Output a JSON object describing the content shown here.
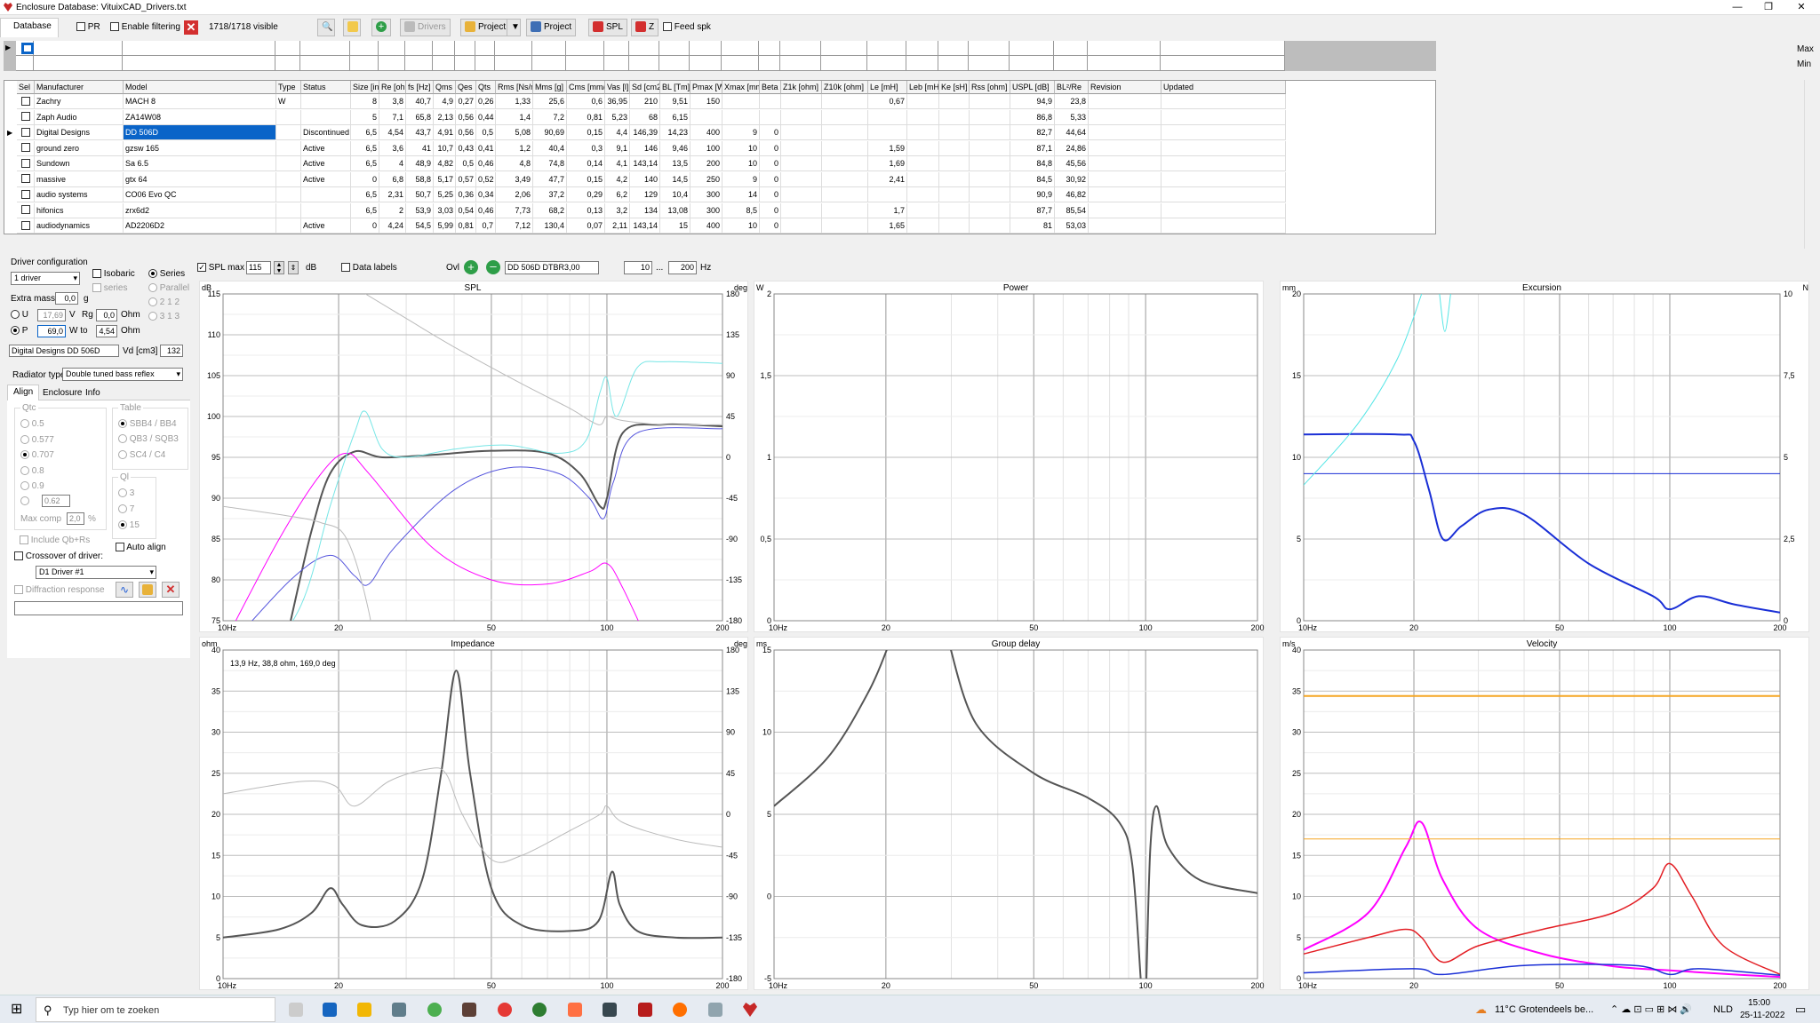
{
  "window": {
    "title": "Enclosure  Database: VituixCAD_Drivers.txt"
  },
  "toolbar": {
    "tab": "Database",
    "pr_label": "PR",
    "filter_label": "Enable filtering",
    "visible_count": "1718/1718 visible",
    "drivers_label": "Drivers",
    "project_label": "Project",
    "project2_label": "Project",
    "spl_label": "SPL",
    "z_label": "Z",
    "feedspk_label": "Feed spk"
  },
  "filter": {
    "max_label": "Max",
    "min_label": "Min"
  },
  "grid": {
    "columns": [
      "Sel",
      "Manufacturer",
      "Model",
      "Type",
      "Status",
      "Size [in]",
      "Re [ohm]",
      "fs [Hz]",
      "Qms",
      "Qes",
      "Qts",
      "Rms [Ns/m]",
      "Mms [g]",
      "Cms [mm/N]",
      "Vas [l]",
      "Sd [cm2]",
      "BL [Tm]",
      "Pmax [W]",
      "Xmax [mm]",
      "Beta",
      "Z1k [ohm]",
      "Z10k [ohm]",
      "Le [mH]",
      "Leb [mH]",
      "Ke [sH]",
      "Rss [ohm]",
      "USPL [dB]",
      "BL²/Re",
      "Revision",
      "Updated"
    ],
    "rows": [
      [
        "",
        "Zachry",
        "MACH 8",
        "W",
        "",
        "8",
        "3,8",
        "40,7",
        "4,9",
        "0,27",
        "0,26",
        "1,33",
        "25,6",
        "0,6",
        "36,95",
        "210",
        "9,51",
        "150",
        "",
        "",
        "",
        "",
        "0,67",
        "",
        "",
        "",
        "94,9",
        "23,8",
        "",
        ""
      ],
      [
        "",
        "Zaph Audio",
        "ZA14W08",
        "",
        "",
        "5",
        "7,1",
        "65,8",
        "2,13",
        "0,56",
        "0,44",
        "1,4",
        "7,2",
        "0,81",
        "5,23",
        "68",
        "6,15",
        "",
        "",
        "",
        "",
        "",
        "",
        "",
        "",
        "",
        "86,8",
        "5,33",
        "",
        ""
      ],
      [
        "",
        "Digital Designs",
        "DD 506D",
        "",
        "Discontinued",
        "6,5",
        "4,54",
        "43,7",
        "4,91",
        "0,56",
        "0,5",
        "5,08",
        "90,69",
        "0,15",
        "4,4",
        "146,39",
        "14,23",
        "400",
        "9",
        "0",
        "",
        "",
        "",
        "",
        "",
        "",
        "82,7",
        "44,64",
        "",
        ""
      ],
      [
        "",
        "ground zero",
        "gzsw 165",
        "",
        "Active",
        "6,5",
        "3,6",
        "41",
        "10,7",
        "0,43",
        "0,41",
        "1,2",
        "40,4",
        "0,3",
        "9,1",
        "146",
        "9,46",
        "100",
        "10",
        "0",
        "",
        "",
        "1,59",
        "",
        "",
        "",
        "87,1",
        "24,86",
        "",
        ""
      ],
      [
        "",
        "Sundown",
        "Sa 6.5",
        "",
        "Active",
        "6,5",
        "4",
        "48,9",
        "4,82",
        "0,5",
        "0,46",
        "4,8",
        "74,8",
        "0,14",
        "4,1",
        "143,14",
        "13,5",
        "200",
        "10",
        "0",
        "",
        "",
        "1,69",
        "",
        "",
        "",
        "84,8",
        "45,56",
        "",
        ""
      ],
      [
        "",
        "massive",
        "gtx 64",
        "",
        "Active",
        "0",
        "6,8",
        "58,8",
        "5,17",
        "0,57",
        "0,52",
        "3,49",
        "47,7",
        "0,15",
        "4,2",
        "140",
        "14,5",
        "250",
        "9",
        "0",
        "",
        "",
        "2,41",
        "",
        "",
        "",
        "84,5",
        "30,92",
        "",
        ""
      ],
      [
        "",
        "audio systems",
        "CO06 Evo QC",
        "",
        "",
        "6,5",
        "2,31",
        "50,7",
        "5,25",
        "0,36",
        "0,34",
        "2,06",
        "37,2",
        "0,29",
        "6,2",
        "129",
        "10,4",
        "300",
        "14",
        "0",
        "",
        "",
        "",
        "",
        "",
        "",
        "90,9",
        "46,82",
        "",
        ""
      ],
      [
        "",
        "hifonics",
        "zrx6d2",
        "",
        "",
        "6,5",
        "2",
        "53,9",
        "3,03",
        "0,54",
        "0,46",
        "7,73",
        "68,2",
        "0,13",
        "3,2",
        "134",
        "13,08",
        "300",
        "8,5",
        "0",
        "",
        "",
        "1,7",
        "",
        "",
        "",
        "87,7",
        "85,54",
        "",
        ""
      ],
      [
        "",
        "audiodynamics",
        "AD2206D2",
        "",
        "Active",
        "0",
        "4,24",
        "54,5",
        "5,99",
        "0,81",
        "0,7",
        "7,12",
        "130,4",
        "0,07",
        "2,11",
        "143,14",
        "15",
        "400",
        "10",
        "0",
        "",
        "",
        "1,65",
        "",
        "",
        "",
        "81",
        "53,03",
        "",
        ""
      ]
    ]
  },
  "left": {
    "driver_config": "Driver configuration",
    "drivers_sel": "1 driver",
    "isobaric": "Isobaric",
    "series": "Series",
    "series2": "series",
    "parallel": "Parallel",
    "extra_mass": "Extra mass",
    "extra_mass_val": "0,0",
    "g": "g",
    "u": "U",
    "u_val": "17,69",
    "v": "V",
    "rg": "Rg",
    "rg_val": "0,0",
    "ohm": "Ohm",
    "p": "P",
    "p_val": "69,0",
    "wto": "W to",
    "wto_val": "4,54",
    "ohm2": "Ohm",
    "r212": "2 1 2",
    "r313": "3 1 3",
    "driver_name": "Digital Designs DD 506D",
    "vd_label": "Vd [cm3]",
    "vd_val": "132",
    "radiator_label": "Radiator type",
    "radiator_val": "Double tuned bass reflex",
    "tabs": [
      "Align",
      "Enclosure",
      "Info"
    ],
    "qtc": "Qtc",
    "qtc_opts": [
      "0.5",
      "0.577",
      "0.707",
      "0.8",
      "0.9"
    ],
    "qtc_custom": "0.62",
    "table": "Table",
    "table_opts": [
      "SBB4 / BB4",
      "QB3 / SQB3",
      "SC4 / C4"
    ],
    "ql": "Ql",
    "ql_opts": [
      "3",
      "7",
      "15"
    ],
    "max_comp": "Max comp",
    "max_comp_val": "2,0",
    "pct": "%",
    "include": "Include Qb+Rs",
    "auto_align": "Auto align",
    "crossover": "Crossover of driver:",
    "crossover_sel": "D1 Driver #1",
    "diffraction": "Diffraction response"
  },
  "chartbar": {
    "splmax": "SPL max",
    "splmax_val": "115",
    "db": "dB",
    "datalabels": "Data labels",
    "ovl": "Ovl",
    "ovl_val": "DD 506D DTBR3,00",
    "f1": "10",
    "dots": "...",
    "f2": "200",
    "hz": "Hz"
  },
  "charts": {
    "spl": {
      "title": "SPL",
      "lunit": "dB",
      "runit": "deg",
      "yl": [
        "115",
        "110",
        "105",
        "100",
        "95",
        "90",
        "85",
        "80",
        "75"
      ],
      "yr": [
        "180",
        "135",
        "90",
        "45",
        "0",
        "-45",
        "-90",
        "-135",
        "-180"
      ],
      "x": [
        "10Hz",
        "20",
        "50",
        "100",
        "200"
      ]
    },
    "power": {
      "title": "Power",
      "lunit": "W",
      "yl": [
        "2",
        "1,5",
        "1",
        "0,5",
        "0"
      ],
      "x": [
        "10Hz",
        "20",
        "50",
        "100",
        "200"
      ]
    },
    "excursion": {
      "title": "Excursion",
      "lunit": "mm",
      "runit": "N",
      "yl": [
        "20",
        "15",
        "10",
        "5",
        "0"
      ],
      "yr": [
        "10",
        "7,5",
        "5",
        "2,5",
        "0"
      ],
      "x": [
        "10Hz",
        "20",
        "50",
        "100",
        "200"
      ]
    },
    "impedance": {
      "title": "Impedance",
      "lunit": "ohm",
      "runit": "deg",
      "annot": "13,9 Hz, 38,8 ohm, 169,0 deg",
      "yl": [
        "40",
        "35",
        "30",
        "25",
        "20",
        "15",
        "10",
        "5",
        "0"
      ],
      "yr": [
        "180",
        "135",
        "90",
        "45",
        "0",
        "-45",
        "-90",
        "-135",
        "-180"
      ],
      "x": [
        "10Hz",
        "20",
        "50",
        "100",
        "200"
      ]
    },
    "groupdelay": {
      "title": "Group delay",
      "lunit": "ms",
      "yl": [
        "15",
        "10",
        "5",
        "0",
        "-5"
      ],
      "x": [
        "10Hz",
        "20",
        "50",
        "100",
        "200"
      ]
    },
    "velocity": {
      "title": "Velocity",
      "lunit": "m/s",
      "yl": [
        "40",
        "35",
        "30",
        "25",
        "20",
        "15",
        "10",
        "5",
        "0"
      ],
      "x": [
        "10Hz",
        "20",
        "50",
        "100",
        "200"
      ]
    }
  },
  "taskbar": {
    "search": "Typ hier om te zoeken",
    "weather": "11°C  Grotendeels be...",
    "lang": "NLD",
    "time": "15:00",
    "date": "25-11-2022"
  }
}
